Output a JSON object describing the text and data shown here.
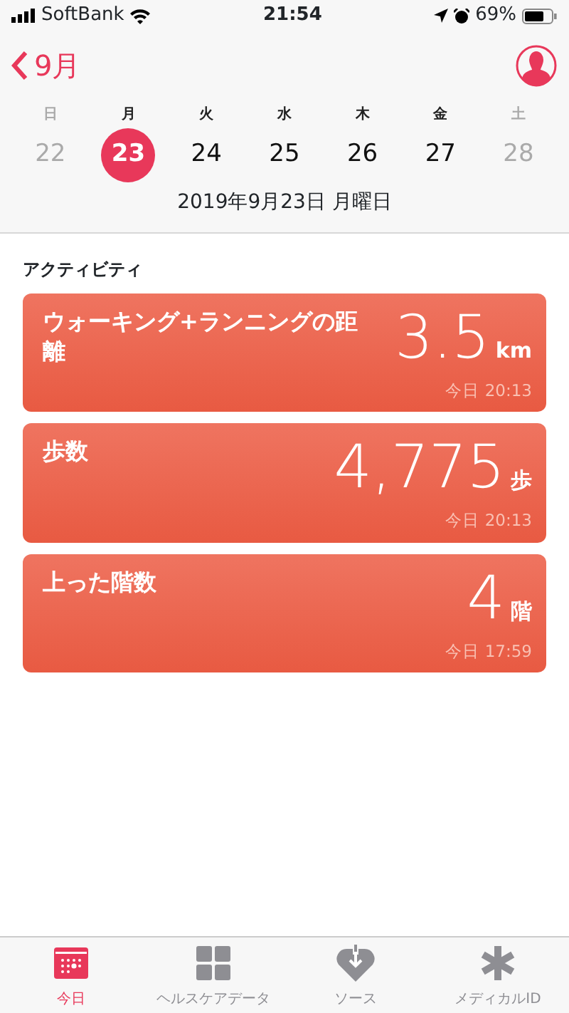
{
  "status_bar": {
    "carrier": "SoftBank",
    "time": "21:54",
    "battery": "69%"
  },
  "nav": {
    "back": "9月"
  },
  "week": [
    {
      "weekday": "日",
      "day": "22",
      "muted": true,
      "selected": false
    },
    {
      "weekday": "月",
      "day": "23",
      "muted": false,
      "selected": true
    },
    {
      "weekday": "火",
      "day": "24",
      "muted": false,
      "selected": false
    },
    {
      "weekday": "水",
      "day": "25",
      "muted": false,
      "selected": false
    },
    {
      "weekday": "木",
      "day": "26",
      "muted": false,
      "selected": false
    },
    {
      "weekday": "金",
      "day": "27",
      "muted": false,
      "selected": false
    },
    {
      "weekday": "土",
      "day": "28",
      "muted": true,
      "selected": false
    }
  ],
  "date_label": "2019年9月23日 月曜日",
  "section_title": "アクティビティ",
  "cards": [
    {
      "title": "ウォーキング+ランニングの距離",
      "value": "3.5",
      "unit": "km",
      "time": "今日 20:13"
    },
    {
      "title": "歩数",
      "value": "4,775",
      "unit": "歩",
      "time": "今日 20:13"
    },
    {
      "title": "上った階数",
      "value": "4",
      "unit": "階",
      "time": "今日 17:59"
    }
  ],
  "tabs": [
    {
      "kind": "today",
      "label": "今日",
      "selected": true
    },
    {
      "kind": "data",
      "label": "ヘルスケアデータ",
      "selected": false
    },
    {
      "kind": "sources",
      "label": "ソース",
      "selected": false
    },
    {
      "kind": "medical",
      "label": "メディカルID",
      "selected": false
    }
  ]
}
